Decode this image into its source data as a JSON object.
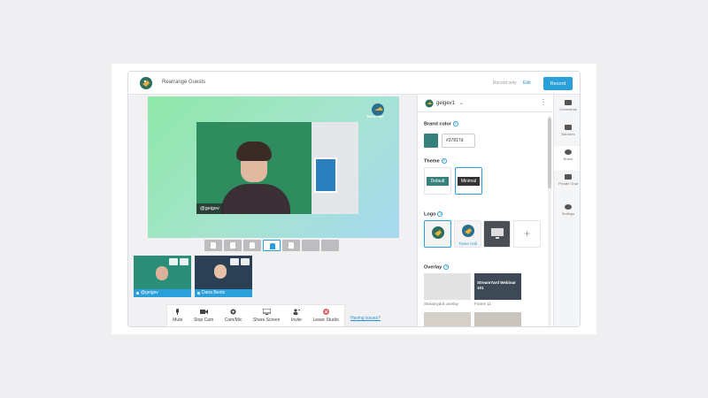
{
  "header": {
    "title": "Rearrange Guests",
    "record_only": "Record only",
    "edit": "Edit",
    "record": "Record"
  },
  "stage": {
    "brand_text": "Twine Hall",
    "main_camera_label": "@geigev"
  },
  "layouts": [
    "solo",
    "group-2",
    "group-3",
    "group-sel",
    "side-by-side",
    "split",
    "full"
  ],
  "guests": [
    {
      "name": "@geigev"
    },
    {
      "name": "Dana Bentz"
    }
  ],
  "controls": {
    "mute": "Mute",
    "stop_cam": "Stop Cam",
    "cam_mic": "Cam/Mic",
    "share_screen": "Share Screen",
    "invite": "Invite",
    "leave_studio": "Leave Studio",
    "having_issues": "Having issues?"
  },
  "panel": {
    "brand_name": "geigev1",
    "brand_color_title": "Brand color",
    "brand_color_hex": "#37817d",
    "theme_title": "Theme",
    "theme_default": "Default",
    "theme_minimal": "Minimal",
    "logo_title": "Logo",
    "logo_caption": "Twine Hall",
    "overlay_title": "Overlay",
    "overlays": [
      {
        "caption": "Streamyard overlay",
        "text": ""
      },
      {
        "caption": "Frame 11",
        "text": "StreamYard Webinar 101"
      }
    ]
  },
  "rail": {
    "comments": "Comments",
    "banners": "Banners",
    "brand": "Brand",
    "private_chat": "Private Chat",
    "settings": "Settings"
  },
  "colors": {
    "accent": "#2b9fd9",
    "brand": "#37817d"
  }
}
